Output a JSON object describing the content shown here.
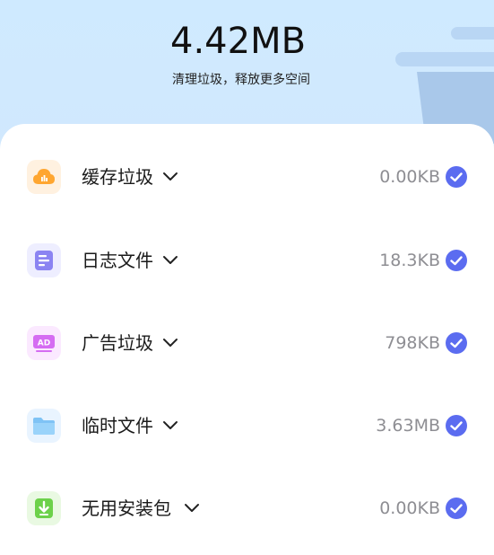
{
  "header": {
    "total_size": "4.42MB",
    "caption": "清理垃圾，释放更多空间"
  },
  "colors": {
    "accent": "#5b6cf0",
    "card": "#ffffff",
    "header_bg": "#cfeaff"
  },
  "items": [
    {
      "label": "缓存垃圾",
      "size": "0.00KB",
      "icon": "cloud-icon",
      "checked": true
    },
    {
      "label": "日志文件",
      "size": "18.3KB",
      "icon": "log-file-icon",
      "checked": true
    },
    {
      "label": "广告垃圾",
      "size": "798KB",
      "icon": "ad-icon",
      "checked": true
    },
    {
      "label": "临时文件",
      "size": "3.63MB",
      "icon": "folder-icon",
      "checked": true
    },
    {
      "label": "无用安装包",
      "size": "0.00KB",
      "icon": "apk-download-icon",
      "checked": true
    }
  ]
}
